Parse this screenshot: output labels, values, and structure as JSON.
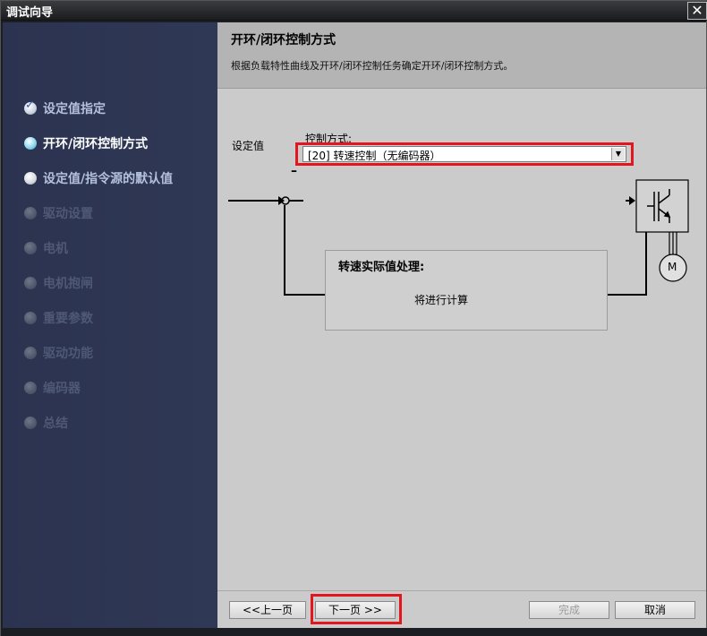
{
  "window": {
    "title": "调试向导",
    "close_glyph": "✕"
  },
  "sidebar": {
    "items": [
      {
        "label": "设定值指定",
        "state": "done"
      },
      {
        "label": "开环/闭环控制方式",
        "state": "current"
      },
      {
        "label": "设定值/指令源的默认值",
        "state": "normal"
      },
      {
        "label": "驱动设置",
        "state": "disabled"
      },
      {
        "label": "电机",
        "state": "disabled"
      },
      {
        "label": "电机抱闸",
        "state": "disabled"
      },
      {
        "label": "重要参数",
        "state": "disabled"
      },
      {
        "label": "驱动功能",
        "state": "disabled"
      },
      {
        "label": "编码器",
        "state": "disabled"
      },
      {
        "label": "总结",
        "state": "disabled"
      }
    ]
  },
  "header": {
    "title": "开环/闭环控制方式",
    "description": "根据负载特性曲线及开环/闭环控制任务确定开环/闭环控制方式。"
  },
  "diagram": {
    "setpoint_label": "设定值",
    "control_mode_label": "控制方式:",
    "control_mode_value": "[20] 转速控制（无编码器）",
    "minus_sign": "–",
    "motor_label": "M",
    "speed_processing_title": "转速实际值处理:",
    "speed_processing_value": "将进行计算"
  },
  "footer": {
    "prev_label": "<<上一页",
    "next_label": "下一页 >>",
    "finish_label": "完成",
    "cancel_label": "取消"
  },
  "colors": {
    "highlight": "#e3161d",
    "sidebar_bg": "#2f3854",
    "content_bg": "#cbcbcb"
  }
}
